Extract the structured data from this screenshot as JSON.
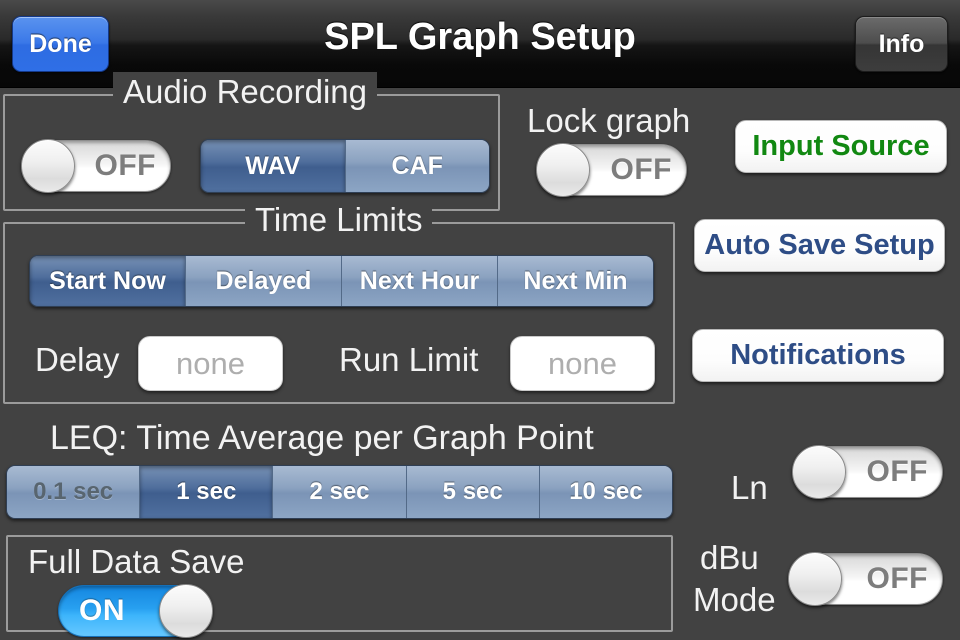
{
  "navbar": {
    "done_label": "Done",
    "title": "SPL Graph Setup",
    "info_label": "Info"
  },
  "audio_recording": {
    "legend": "Audio Recording",
    "toggle": {
      "name": "audio-recording",
      "state": "OFF"
    },
    "format_segments": [
      {
        "label": "WAV",
        "selected": true
      },
      {
        "label": "CAF",
        "selected": false
      }
    ]
  },
  "lock_graph": {
    "label": "Lock graph",
    "toggle": {
      "name": "lock-graph",
      "state": "OFF"
    }
  },
  "time_limits": {
    "legend": "Time Limits",
    "segments": [
      {
        "label": "Start Now",
        "selected": true
      },
      {
        "label": "Delayed",
        "selected": false
      },
      {
        "label": "Next Hour",
        "selected": false
      },
      {
        "label": "Next Min",
        "selected": false
      }
    ],
    "delay_label": "Delay",
    "delay_value": "none",
    "delay_placeholder": "none",
    "run_limit_label": "Run Limit",
    "run_limit_value": "none",
    "run_limit_placeholder": "none"
  },
  "leq": {
    "title": "LEQ: Time Average per Graph Point",
    "segments": [
      {
        "label": "0.1 sec",
        "selected": false,
        "disabled": true
      },
      {
        "label": "1 sec",
        "selected": true,
        "disabled": false
      },
      {
        "label": "2 sec",
        "selected": false,
        "disabled": false
      },
      {
        "label": "5 sec",
        "selected": false,
        "disabled": false
      },
      {
        "label": "10 sec",
        "selected": false,
        "disabled": false
      }
    ]
  },
  "full_data_save": {
    "label": "Full Data Save",
    "toggle": {
      "name": "full-data-save",
      "state": "ON"
    }
  },
  "right_buttons": [
    {
      "label": "Input Source",
      "color": "#118811"
    },
    {
      "label": "Auto Save Setup",
      "color": "#2e4d86"
    },
    {
      "label": "Notifications",
      "color": "#2e4d86"
    }
  ],
  "ln": {
    "label": "Ln",
    "toggle": {
      "name": "ln",
      "state": "OFF"
    }
  },
  "dbu_mode": {
    "label_line1": "dBu",
    "label_line2": "Mode",
    "toggle": {
      "name": "dbu-mode",
      "state": "OFF"
    }
  },
  "colors": {
    "background": "#424242",
    "accent_blue": "#2f6fe6",
    "toggle_on": "#28a0f0",
    "green": "#118811",
    "navy": "#2e4d86"
  }
}
